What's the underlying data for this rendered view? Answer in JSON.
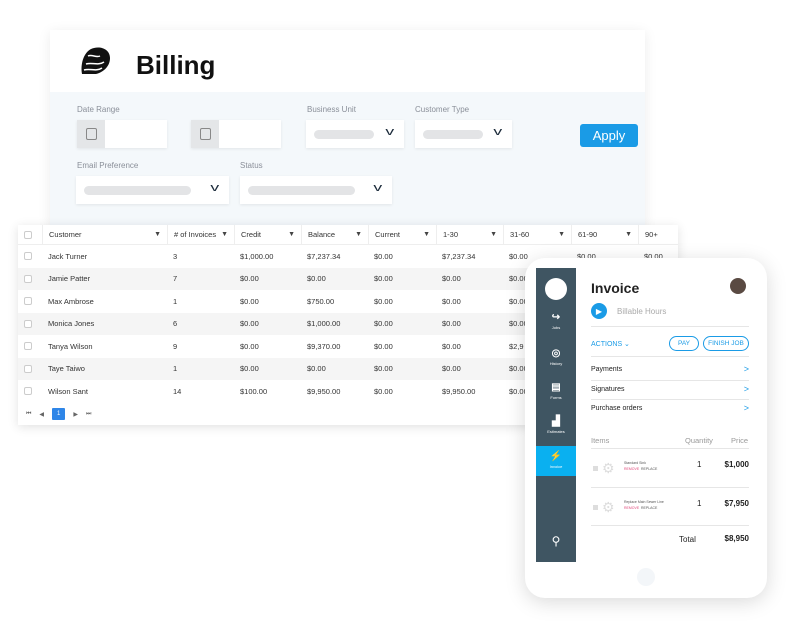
{
  "billing": {
    "title": "Billing",
    "filters": {
      "date_range": "Date Range",
      "business_unit": "Business Unit",
      "customer_type": "Customer Type",
      "email_preference": "Email Preference",
      "status": "Status",
      "apply": "Apply"
    }
  },
  "table": {
    "columns": [
      "Customer",
      "# of Invoices",
      "Credit",
      "Balance",
      "Current",
      "1-30",
      "31-60",
      "61-90",
      "90+"
    ],
    "rows": [
      [
        "Jack Turner",
        "3",
        "$1,000.00",
        "$7,237.34",
        "$0.00",
        "$7,237.34",
        "$0.00",
        "$0.00",
        "$0.00"
      ],
      [
        "Jamie Patter",
        "7",
        "$0.00",
        "$0.00",
        "$0.00",
        "$0.00",
        "$0.00",
        "",
        ""
      ],
      [
        "Max Ambrose",
        "1",
        "$0.00",
        "$750.00",
        "$0.00",
        "$0.00",
        "$0.00",
        "",
        ""
      ],
      [
        "Monica Jones",
        "6",
        "$0.00",
        "$1,000.00",
        "$0.00",
        "$0.00",
        "$0.00",
        "",
        ""
      ],
      [
        "Tanya Wilson",
        "9",
        "$0.00",
        "$9,370.00",
        "$0.00",
        "$0.00",
        "$2,9",
        "",
        ""
      ],
      [
        "Taye Taiwo",
        "1",
        "$0.00",
        "$0.00",
        "$0.00",
        "$0.00",
        "$0.00",
        "",
        ""
      ],
      [
        "Wilson Sant",
        "14",
        "$100.00",
        "$9,950.00",
        "$0.00",
        "$9,950.00",
        "$0.00",
        "",
        ""
      ]
    ],
    "pager": {
      "first": "⏮",
      "prev": "◀",
      "page": "1",
      "next": "▶",
      "last": "⏭"
    }
  },
  "phone": {
    "nav": [
      {
        "label": "Jobs",
        "icon": "↪"
      },
      {
        "label": "History",
        "icon": "◎"
      },
      {
        "label": "Forms",
        "icon": "▤"
      },
      {
        "label": "Estimates",
        "icon": "▟"
      },
      {
        "label": "Invoice",
        "icon": "⚡"
      }
    ],
    "title": "Invoice",
    "timer": "Billable Hours",
    "actions": "ACTIONS ⌄",
    "pay": "PAY",
    "finish": "FINISH JOB",
    "links": [
      "Payments",
      "Signatures",
      "Purchase orders"
    ],
    "items_header": {
      "items": "Items",
      "quantity": "Quantity",
      "price": "Price"
    },
    "items": [
      {
        "name": "Standard Sink",
        "remove": "REMOVE",
        "replace": "REPLACE",
        "qty": "1",
        "price": "$1,000"
      },
      {
        "name": "Replace Main Sewer Line",
        "remove": "REMOVE",
        "replace": "REPLACE",
        "qty": "1",
        "price": "$7,950"
      }
    ],
    "total_label": "Total",
    "total": "$8,950"
  },
  "colors": {
    "accent": "#1a9be6",
    "sidebar": "#3f5562",
    "active_nav": "#0ab0f0",
    "remove": "#e0487a"
  }
}
